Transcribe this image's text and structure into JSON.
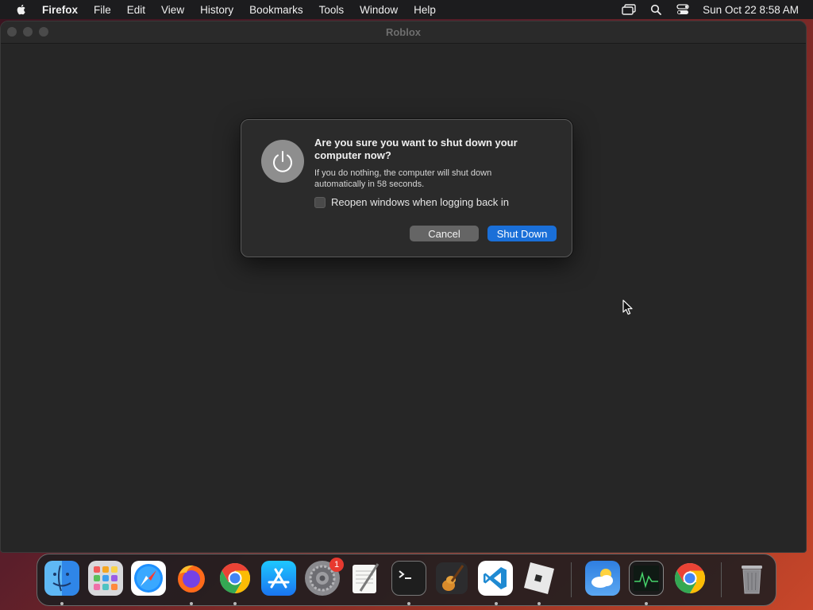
{
  "menubar": {
    "app_name": "Firefox",
    "items": [
      "File",
      "Edit",
      "View",
      "History",
      "Bookmarks",
      "Tools",
      "Window",
      "Help"
    ],
    "clock": "Sun Oct 22  8:58 AM",
    "status_icons": [
      "screen-mirroring-icon",
      "spotlight-search-icon",
      "control-center-icon"
    ]
  },
  "window": {
    "title": "Roblox"
  },
  "dialog": {
    "heading": "Are you sure you want to shut down your computer now?",
    "body": "If you do nothing, the computer will shut down automatically in 58 seconds.",
    "checkbox_label": "Reopen windows when logging back in",
    "checkbox_checked": false,
    "cancel_label": "Cancel",
    "confirm_label": "Shut Down",
    "accent_color": "#1a6fd8",
    "icon": "power-icon"
  },
  "dock": {
    "apps": [
      {
        "name": "Finder",
        "icon": "finder-icon",
        "running": true
      },
      {
        "name": "Launchpad",
        "icon": "launchpad-icon",
        "running": false
      },
      {
        "name": "Safari",
        "icon": "safari-icon",
        "running": false
      },
      {
        "name": "Firefox",
        "icon": "firefox-icon",
        "running": true
      },
      {
        "name": "Google Chrome",
        "icon": "chrome-icon",
        "running": true
      },
      {
        "name": "App Store",
        "icon": "app-store-icon",
        "running": false
      },
      {
        "name": "System Settings",
        "icon": "system-settings-icon",
        "running": false,
        "badge": "1"
      },
      {
        "name": "TextEdit",
        "icon": "textedit-icon",
        "running": false
      },
      {
        "name": "Terminal",
        "icon": "terminal-icon",
        "running": true
      },
      {
        "name": "GarageBand",
        "icon": "garageband-icon",
        "running": false
      },
      {
        "name": "Visual Studio Code",
        "icon": "vscode-icon",
        "running": true
      },
      {
        "name": "Roblox",
        "icon": "roblox-icon",
        "running": true
      },
      {
        "name": "Weather",
        "icon": "weather-icon",
        "running": false
      },
      {
        "name": "Activity Monitor",
        "icon": "activity-monitor-icon",
        "running": true
      },
      {
        "name": "Google Chrome",
        "icon": "chrome-icon",
        "running": false
      },
      {
        "name": "Trash",
        "icon": "trash-icon",
        "running": false
      }
    ]
  }
}
